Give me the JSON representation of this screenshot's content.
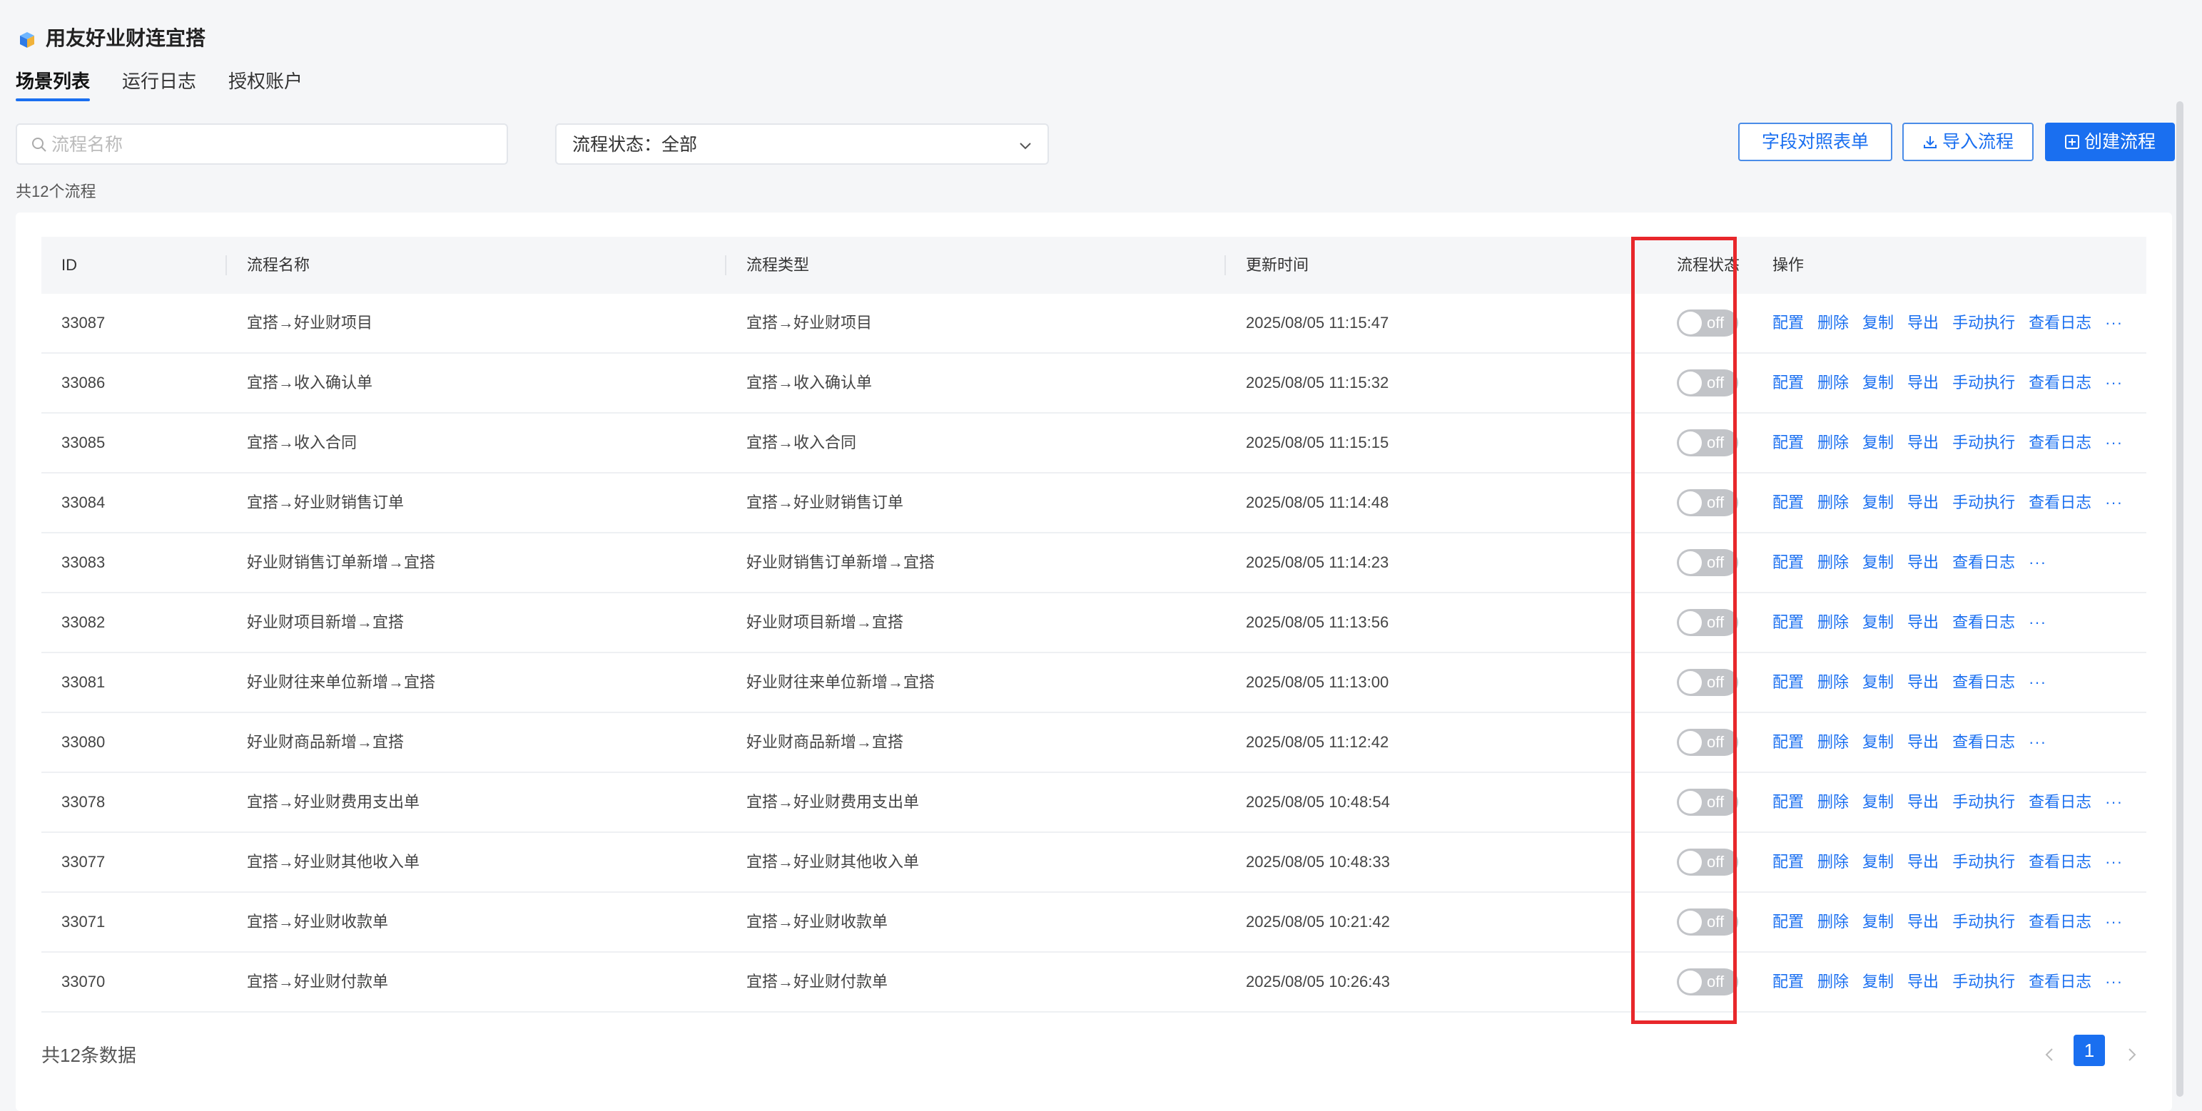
{
  "app": {
    "title": "用友好业财连宜搭"
  },
  "tabs": [
    {
      "label": "场景列表",
      "active": true
    },
    {
      "label": "运行日志",
      "active": false
    },
    {
      "label": "授权账户",
      "active": false
    }
  ],
  "filters": {
    "search_placeholder": "流程名称",
    "search_value": "",
    "status_label": "流程状态：全部"
  },
  "toolbar": {
    "field_map_label": "字段对照表单",
    "import_label": "导入流程",
    "create_label": "创建流程"
  },
  "count_text": "共12个流程",
  "table": {
    "columns": [
      "ID",
      "流程名称",
      "流程类型",
      "更新时间",
      "流程状态",
      "操作"
    ],
    "rows": [
      {
        "id": "33087",
        "name": "宜搭→好业财项目",
        "type": "宜搭→好业财项目",
        "updated": "2025/08/05 11:15:47",
        "status": "off",
        "ops": [
          "配置",
          "删除",
          "复制",
          "导出",
          "手动执行",
          "查看日志"
        ]
      },
      {
        "id": "33086",
        "name": "宜搭→收入确认单",
        "type": "宜搭→收入确认单",
        "updated": "2025/08/05 11:15:32",
        "status": "off",
        "ops": [
          "配置",
          "删除",
          "复制",
          "导出",
          "手动执行",
          "查看日志"
        ]
      },
      {
        "id": "33085",
        "name": "宜搭→收入合同",
        "type": "宜搭→收入合同",
        "updated": "2025/08/05 11:15:15",
        "status": "off",
        "ops": [
          "配置",
          "删除",
          "复制",
          "导出",
          "手动执行",
          "查看日志"
        ]
      },
      {
        "id": "33084",
        "name": "宜搭→好业财销售订单",
        "type": "宜搭→好业财销售订单",
        "updated": "2025/08/05 11:14:48",
        "status": "off",
        "ops": [
          "配置",
          "删除",
          "复制",
          "导出",
          "手动执行",
          "查看日志"
        ]
      },
      {
        "id": "33083",
        "name": "好业财销售订单新增→宜搭",
        "type": "好业财销售订单新增→宜搭",
        "updated": "2025/08/05 11:14:23",
        "status": "off",
        "ops": [
          "配置",
          "删除",
          "复制",
          "导出",
          "查看日志"
        ]
      },
      {
        "id": "33082",
        "name": "好业财项目新增→宜搭",
        "type": "好业财项目新增→宜搭",
        "updated": "2025/08/05 11:13:56",
        "status": "off",
        "ops": [
          "配置",
          "删除",
          "复制",
          "导出",
          "查看日志"
        ]
      },
      {
        "id": "33081",
        "name": "好业财往来单位新增→宜搭",
        "type": "好业财往来单位新增→宜搭",
        "updated": "2025/08/05 11:13:00",
        "status": "off",
        "ops": [
          "配置",
          "删除",
          "复制",
          "导出",
          "查看日志"
        ]
      },
      {
        "id": "33080",
        "name": "好业财商品新增→宜搭",
        "type": "好业财商品新增→宜搭",
        "updated": "2025/08/05 11:12:42",
        "status": "off",
        "ops": [
          "配置",
          "删除",
          "复制",
          "导出",
          "查看日志"
        ]
      },
      {
        "id": "33078",
        "name": "宜搭→好业财费用支出单",
        "type": "宜搭→好业财费用支出单",
        "updated": "2025/08/05 10:48:54",
        "status": "off",
        "ops": [
          "配置",
          "删除",
          "复制",
          "导出",
          "手动执行",
          "查看日志"
        ]
      },
      {
        "id": "33077",
        "name": "宜搭→好业财其他收入单",
        "type": "宜搭→好业财其他收入单",
        "updated": "2025/08/05 10:48:33",
        "status": "off",
        "ops": [
          "配置",
          "删除",
          "复制",
          "导出",
          "手动执行",
          "查看日志"
        ]
      },
      {
        "id": "33071",
        "name": "宜搭→好业财收款单",
        "type": "宜搭→好业财收款单",
        "updated": "2025/08/05 10:21:42",
        "status": "off",
        "ops": [
          "配置",
          "删除",
          "复制",
          "导出",
          "手动执行",
          "查看日志"
        ]
      },
      {
        "id": "33070",
        "name": "宜搭→好业财付款单",
        "type": "宜搭→好业财付款单",
        "updated": "2025/08/05 10:26:43",
        "status": "off",
        "ops": [
          "配置",
          "删除",
          "复制",
          "导出",
          "手动执行",
          "查看日志"
        ]
      }
    ],
    "more_label": "···"
  },
  "footer": {
    "total_text": "共12条数据",
    "current_page": "1"
  },
  "icons": {
    "logo": "app-logo-icon",
    "search": "search-icon",
    "select": "chevron-down-icon",
    "import": "download-icon",
    "create": "plus-square-icon",
    "prev": "chevron-left-icon",
    "next": "chevron-right-icon"
  },
  "colors": {
    "accent": "#1a6ff0",
    "highlight": "#e8272b",
    "toggle_off": "#c2c4c8"
  }
}
